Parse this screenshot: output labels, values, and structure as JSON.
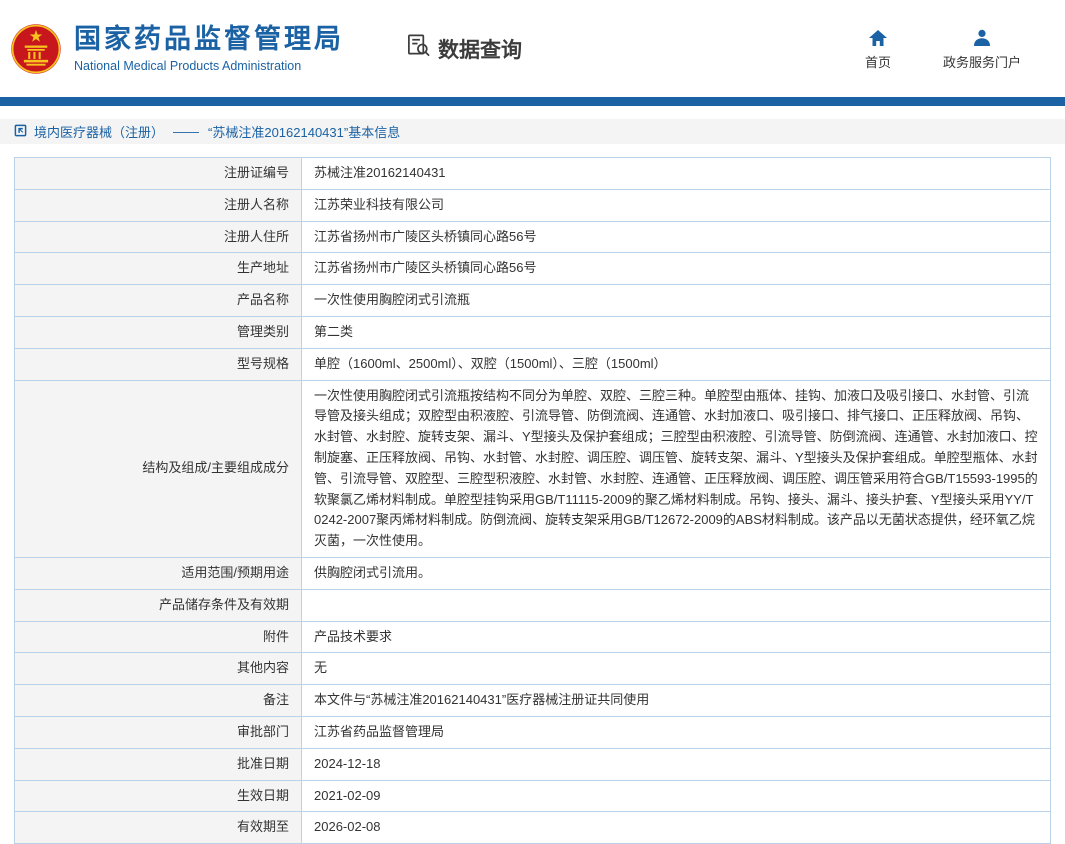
{
  "colors": {
    "accent_blue": "#1b62a5",
    "emblem_red": "#c8161d",
    "emblem_gold": "#f9c31f",
    "table_border": "#b9d2e8",
    "label_bg": "#f4f4f4"
  },
  "header": {
    "site_title": "国家药品监督管理局",
    "site_subtitle": "National Medical Products Administration",
    "section_title": "数据查询",
    "nav": [
      {
        "label": "首页",
        "icon": "home-icon"
      },
      {
        "label": "政务服务门户",
        "icon": "person-icon"
      }
    ]
  },
  "breadcrumb": {
    "category": "境内医疗器械（注册）",
    "separator": "——",
    "current": "“苏械注准20162140431”基本信息"
  },
  "table": {
    "rows": [
      {
        "label": "注册证编号",
        "value": "苏械注准20162140431"
      },
      {
        "label": "注册人名称",
        "value": "江苏荣业科技有限公司"
      },
      {
        "label": "注册人住所",
        "value": "江苏省扬州市广陵区头桥镇同心路56号"
      },
      {
        "label": "生产地址",
        "value": "江苏省扬州市广陵区头桥镇同心路56号"
      },
      {
        "label": "产品名称",
        "value": "一次性使用胸腔闭式引流瓶"
      },
      {
        "label": "管理类别",
        "value": "第二类"
      },
      {
        "label": "型号规格",
        "value": "单腔（1600ml、2500ml）、双腔（1500ml）、三腔（1500ml）"
      },
      {
        "label": "结构及组成/主要组成成分",
        "value": "一次性使用胸腔闭式引流瓶按结构不同分为单腔、双腔、三腔三种。单腔型由瓶体、挂钩、加液口及吸引接口、水封管、引流导管及接头组成；双腔型由积液腔、引流导管、防倒流阀、连通管、水封加液口、吸引接口、排气接口、正压释放阀、吊钩、水封管、水封腔、旋转支架、漏斗、Y型接头及保护套组成；三腔型由积液腔、引流导管、防倒流阀、连通管、水封加液口、控制旋塞、正压释放阀、吊钩、水封管、水封腔、调压腔、调压管、旋转支架、漏斗、Y型接头及保护套组成。单腔型瓶体、水封管、引流导管、双腔型、三腔型积液腔、水封管、水封腔、连通管、正压释放阀、调压腔、调压管采用符合GB/T15593-1995的软聚氯乙烯材料制成。单腔型挂钩采用GB/T11115-2009的聚乙烯材料制成。吊钩、接头、漏斗、接头护套、Y型接头采用YY/T0242-2007聚丙烯材料制成。防倒流阀、旋转支架采用GB/T12672-2009的ABS材料制成。该产品以无菌状态提供，经环氧乙烷灭菌，一次性使用。"
      },
      {
        "label": "适用范围/预期用途",
        "value": "供胸腔闭式引流用。"
      },
      {
        "label": "产品储存条件及有效期",
        "value": ""
      },
      {
        "label": "附件",
        "value": "产品技术要求"
      },
      {
        "label": "其他内容",
        "value": "无"
      },
      {
        "label": "备注",
        "value": "本文件与“苏械注准20162140431”医疗器械注册证共同使用"
      },
      {
        "label": "审批部门",
        "value": "江苏省药品监督管理局"
      },
      {
        "label": "批准日期",
        "value": "2024-12-18"
      },
      {
        "label": "生效日期",
        "value": "2021-02-09"
      },
      {
        "label": "有效期至",
        "value": "2026-02-08"
      }
    ]
  }
}
